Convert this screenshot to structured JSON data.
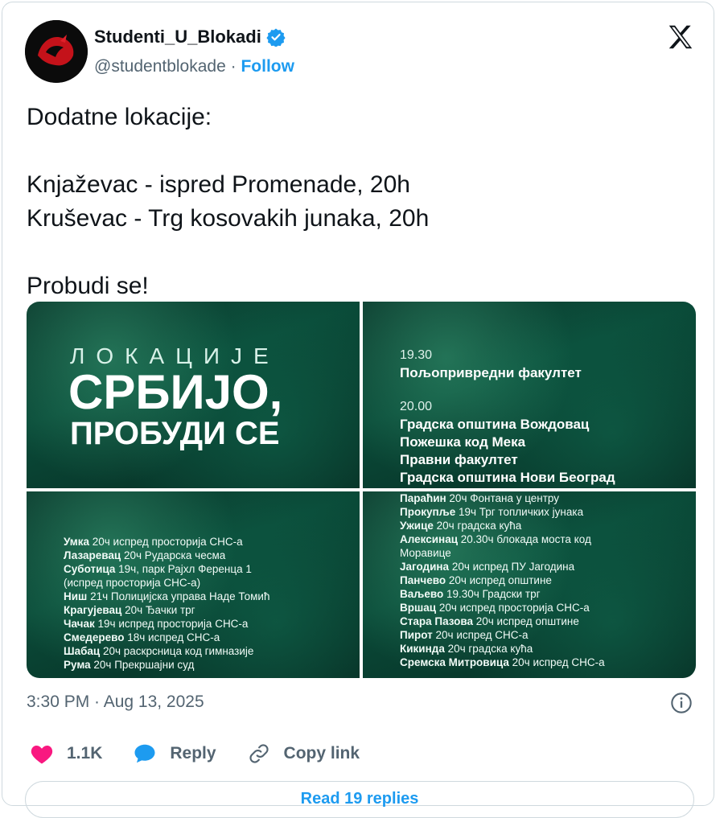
{
  "author": {
    "name": "Studenti_U_Blokadi",
    "handle": "@studentblokade",
    "separator": "·",
    "follow_label": "Follow"
  },
  "tweet": {
    "text": "Dodatne lokacije:\n\nKnjaževac - ispred Promenade, 20h\nKruševac - Trg kosovakih junaka, 20h\n\nProbudi se!"
  },
  "media": {
    "poster_small": "ЛОКАЦИЈЕ",
    "poster_big": "СРБИЈО,",
    "poster_mid": "ПРОБУДИ СЕ",
    "top_right": {
      "time1": "19.30",
      "line1": "Пољопривредни факултет",
      "time2": "20.00",
      "line2": "Градска општина Вождовац",
      "line3": "Пожешка код Мека",
      "line4": "Правни факултет",
      "line5": "Градска општина Нови Београд"
    },
    "bottom_left": [
      {
        "city": "Умка",
        "rest": " 20ч испред просторија СНС-а"
      },
      {
        "city": "Лазаревац",
        "rest": " 20ч Рударска чесма"
      },
      {
        "city": "Суботица",
        "rest": " 19ч, парк Рајхл Ференца 1"
      },
      {
        "city": "",
        "rest": "(испред просторија СНС-а)"
      },
      {
        "city": "Ниш",
        "rest": " 21ч Полицијска управа Наде Томић"
      },
      {
        "city": "Крагујевац",
        "rest": " 20ч Ђачки трг"
      },
      {
        "city": "Чачак",
        "rest": " 19ч испред просторија СНС-а"
      },
      {
        "city": "Смедерево",
        "rest": " 18ч испред СНС-а"
      },
      {
        "city": "Шабац",
        "rest": " 20ч раскрсница код гимназије"
      },
      {
        "city": "Рума",
        "rest": " 20ч Прекршајни суд"
      }
    ],
    "bottom_right": [
      {
        "city": "Параћин",
        "rest": " 20ч Фонтана у центру"
      },
      {
        "city": "Прокупље",
        "rest": " 19ч Трг топличких јунака"
      },
      {
        "city": "Ужице",
        "rest": " 20ч градска кућа"
      },
      {
        "city": "Алексинац",
        "rest": " 20.30ч блокада моста код"
      },
      {
        "city": "",
        "rest": "Моравице"
      },
      {
        "city": "Јагодина",
        "rest": " 20ч испред ПУ Јагодина"
      },
      {
        "city": "Панчево",
        "rest": " 20ч испред општине"
      },
      {
        "city": "Ваљево",
        "rest": " 19.30ч Градски трг"
      },
      {
        "city": "Вршац",
        "rest": " 20ч испред просторија СНС-а"
      },
      {
        "city": "Стара Пазова",
        "rest": " 20ч испред општине"
      },
      {
        "city": "Пирот",
        "rest": " 20ч испред СНС-а"
      },
      {
        "city": "Кикинда",
        "rest": " 20ч градска кућа"
      },
      {
        "city": "Сремска Митровица",
        "rest": " 20ч испред СНС-а"
      }
    ]
  },
  "meta": {
    "timestamp": "3:30 PM · Aug 13, 2025"
  },
  "actions": {
    "likes": "1.1K",
    "reply_label": "Reply",
    "copy_link_label": "Copy link"
  },
  "footer": {
    "read_replies_label": "Read 19 replies"
  },
  "colors": {
    "accent": "#1d9bf0",
    "like": "#f91880",
    "muted": "#536471",
    "media_green": "#0a4a38"
  }
}
